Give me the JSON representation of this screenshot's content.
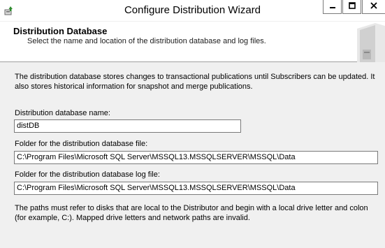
{
  "window": {
    "title": "Configure Distribution Wizard",
    "icons": {
      "app": "wizard-app-icon",
      "minimize": "minimize-icon",
      "maximize": "maximize-icon",
      "close": "close-icon"
    }
  },
  "header": {
    "title": "Distribution Database",
    "subtitle": "Select the name and location of the distribution database and log files.",
    "graphic": "server-icon"
  },
  "body": {
    "intro": "The distribution database stores changes to transactional publications until Subscribers can be updated. It also stores historical information for snapshot and merge publications.",
    "db_name_label": "Distribution database name:",
    "db_name_value": "distDB",
    "db_folder_label": "Folder for the distribution database file:",
    "db_folder_value": "C:\\Program Files\\Microsoft SQL Server\\MSSQL13.MSSQLSERVER\\MSSQL\\Data",
    "log_folder_label": "Folder for the distribution database log file:",
    "log_folder_value": "C:\\Program Files\\Microsoft SQL Server\\MSSQL13.MSSQLSERVER\\MSSQL\\Data",
    "note": "The paths must refer to disks that are local to the Distributor and begin with a local drive letter and colon (for example, C:). Mapped drive letters and network paths are invalid."
  }
}
